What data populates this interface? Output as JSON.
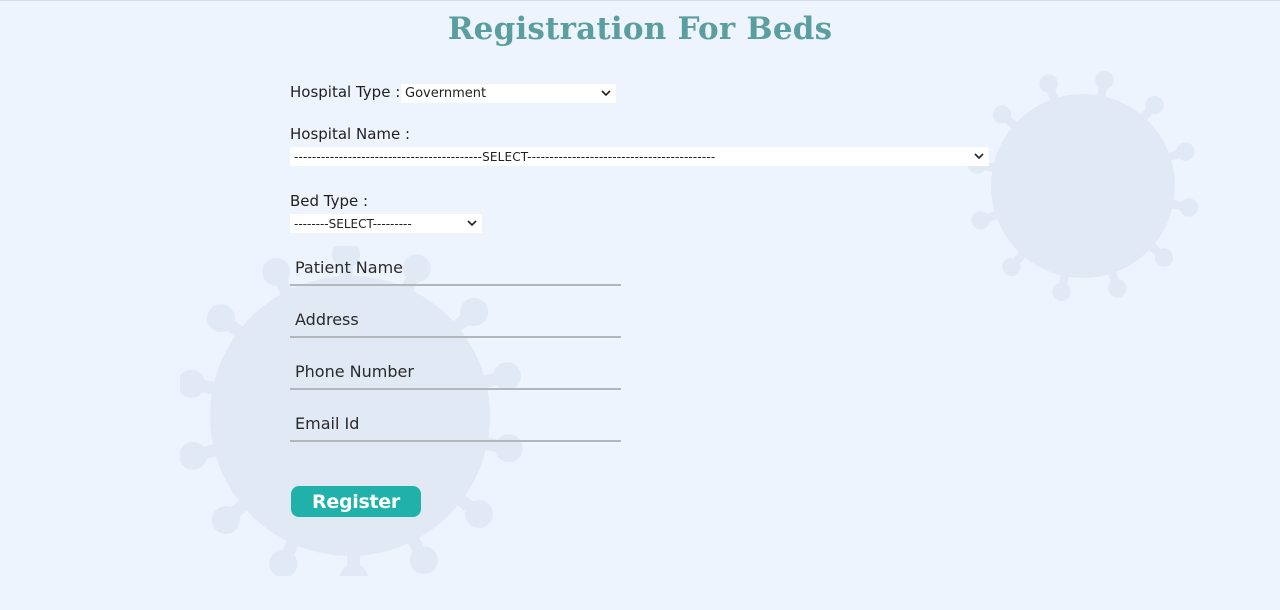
{
  "page": {
    "title": "Registration For Beds"
  },
  "form": {
    "hospital_type": {
      "label": "Hospital Type :",
      "value": "Government"
    },
    "hospital_name": {
      "label": "Hospital Name :",
      "value": "------------------------------------------SELECT------------------------------------------"
    },
    "bed_type": {
      "label": "Bed Type :",
      "value": "--------SELECT---------"
    },
    "patient_name": {
      "placeholder": "Patient Name"
    },
    "address": {
      "placeholder": "Address"
    },
    "phone_number": {
      "placeholder": "Phone Number"
    },
    "email_id": {
      "placeholder": "Email Id"
    },
    "submit_label": "Register"
  },
  "colors": {
    "background": "#eef4fd",
    "title": "#5a9ea0",
    "button": "#20b2aa",
    "underline": "#b3b6ba",
    "virus_decoration": "#e1e9f5"
  },
  "icons": {
    "select_arrow": "chevron-down-icon",
    "background_decoration": "virus-icon"
  }
}
